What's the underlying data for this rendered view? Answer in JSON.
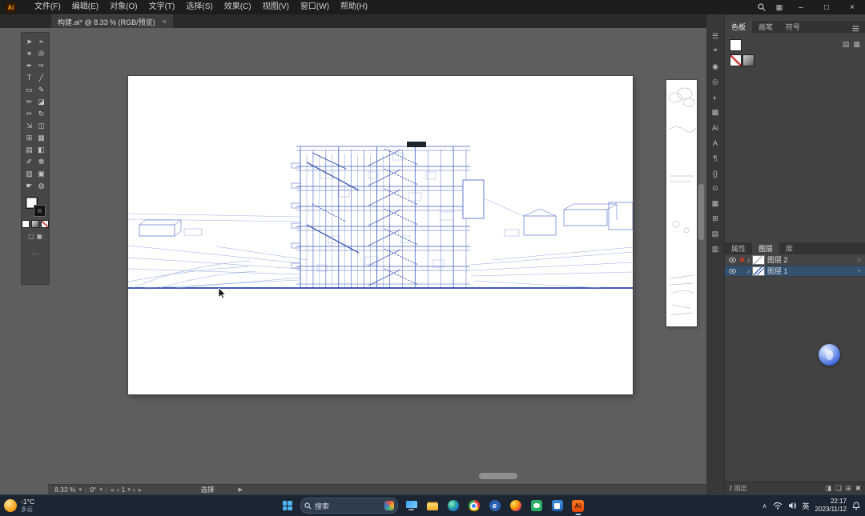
{
  "colors": {
    "selection": "#33506f",
    "ai_orange": "#ff9a00",
    "blueprint": "#3c5cc0",
    "blueprint_dark": "#2344a8",
    "blueprint_light": "#8aa0dc"
  },
  "titlebar": {
    "logo_text": "Ai",
    "menus": [
      "文件(F)",
      "编辑(E)",
      "对象(O)",
      "文字(T)",
      "选择(S)",
      "效果(C)",
      "视图(V)",
      "窗口(W)",
      "帮助(H)"
    ],
    "workspace_glyph": "▦",
    "window_controls": {
      "minimize": "–",
      "restore": "□",
      "close": "×"
    }
  },
  "tabbar": {
    "doc_title": "构建.ai* @ 8.33 % (RGB/预览)",
    "close_glyph": "×"
  },
  "toolbar": {
    "tools": [
      {
        "name": "selection-tool",
        "glyph": "➤"
      },
      {
        "name": "direct-selection-tool",
        "glyph": "➣"
      },
      {
        "name": "magic-wand-tool",
        "glyph": "✶"
      },
      {
        "name": "lasso-tool",
        "glyph": "✇"
      },
      {
        "name": "pen-tool",
        "glyph": "✒"
      },
      {
        "name": "curvature-tool",
        "glyph": "✑"
      },
      {
        "name": "type-tool",
        "glyph": "T"
      },
      {
        "name": "line-segment-tool",
        "glyph": "╱"
      },
      {
        "name": "rectangle-tool",
        "glyph": "▭"
      },
      {
        "name": "paintbrush-tool",
        "glyph": "✎"
      },
      {
        "name": "pencil-tool",
        "glyph": "✏"
      },
      {
        "name": "eraser-tool",
        "glyph": "◪"
      },
      {
        "name": "scissors-tool",
        "glyph": "✂"
      },
      {
        "name": "rotate-tool",
        "glyph": "↻"
      },
      {
        "name": "scale-tool",
        "glyph": "⇲"
      },
      {
        "name": "width-tool",
        "glyph": "◫"
      },
      {
        "name": "free-transform-tool",
        "glyph": "⊞"
      },
      {
        "name": "perspective-grid-tool",
        "glyph": "▦"
      },
      {
        "name": "mesh-tool",
        "glyph": "▤"
      },
      {
        "name": "gradient-tool",
        "glyph": "◧"
      },
      {
        "name": "eyedropper-tool",
        "glyph": "✐"
      },
      {
        "name": "symbol-sprayer-tool",
        "glyph": "❁"
      },
      {
        "name": "column-graph-tool",
        "glyph": "▥"
      },
      {
        "name": "artboard-tool",
        "glyph": "▣"
      },
      {
        "name": "hand-tool",
        "glyph": "☛"
      },
      {
        "name": "zoom-tool",
        "glyph": "◍"
      }
    ],
    "more_glyph": "…"
  },
  "statusbar": {
    "zoom": "8.33 %",
    "caret": "▾",
    "rotation": "0°",
    "nav_first": "«",
    "nav_prev": "‹",
    "artboard_number": "1",
    "nav_next": "›",
    "nav_last": "»",
    "status_text": "选择",
    "expand_glyph": "▶"
  },
  "panel_strip": {
    "icons": [
      {
        "name": "panel-menu-icon",
        "glyph": "☰"
      },
      {
        "name": "comments-panel-icon",
        "glyph": "❝"
      },
      {
        "name": "color-panel-icon",
        "glyph": "◉"
      },
      {
        "name": "color-guide-panel-icon",
        "glyph": "◎"
      },
      {
        "name": "gradient-panel-icon",
        "glyph": "◐"
      },
      {
        "name": "transparency-panel-icon",
        "glyph": "▩"
      },
      {
        "name": "libraries-panel-icon",
        "glyph": "Ai"
      },
      {
        "name": "character-panel-icon",
        "glyph": "A"
      },
      {
        "name": "paragraph-panel-icon",
        "glyph": "¶"
      },
      {
        "name": "opentype-panel-icon",
        "glyph": "{}"
      },
      {
        "name": "appearance-panel-icon",
        "glyph": "⊙"
      },
      {
        "name": "graphic-styles-panel-icon",
        "glyph": "▦"
      },
      {
        "name": "symbols-panel-icon",
        "glyph": "⊞"
      },
      {
        "name": "asset-export-panel-icon",
        "glyph": "▤"
      },
      {
        "name": "artboards-panel-icon",
        "glyph": "▥"
      }
    ]
  },
  "swatches_panel": {
    "tabs": [
      {
        "label": "色板",
        "active": true
      },
      {
        "label": "画笔"
      },
      {
        "label": "符号"
      }
    ],
    "menu_glyph": "≡",
    "view_list_glyph": "▤",
    "view_grid_glyph": "▦"
  },
  "layers_panel": {
    "tabs": [
      {
        "label": "属性"
      },
      {
        "label": "图层",
        "active": true
      },
      {
        "label": "库"
      }
    ],
    "menu_glyph": "≡",
    "rows": [
      {
        "expand": "›",
        "name": "图层 2",
        "target": "○"
      },
      {
        "expand": "›",
        "name": "图层 1",
        "target": "○",
        "selected": true
      }
    ],
    "footer": {
      "count": "2 图层",
      "icons": [
        {
          "name": "make-mask-icon",
          "glyph": "◨"
        },
        {
          "name": "new-sublayer-icon",
          "glyph": "❏"
        },
        {
          "name": "new-layer-icon",
          "glyph": "⊞"
        },
        {
          "name": "delete-layer-icon",
          "glyph": "✖"
        }
      ]
    }
  },
  "taskbar": {
    "weather": {
      "temp": "-1°C",
      "desc": "多云"
    },
    "search_text": "搜索",
    "apps": [
      {
        "name": "monitor"
      },
      {
        "name": "file-explorer"
      },
      {
        "name": "edge"
      },
      {
        "name": "chrome"
      },
      {
        "name": "browser",
        "glyph": "e"
      },
      {
        "name": "firefox"
      },
      {
        "name": "wechat"
      },
      {
        "name": "docs"
      },
      {
        "name": "illustrator",
        "glyph": "Ai",
        "active": true
      }
    ],
    "tray": {
      "chevron": "∧",
      "ime": "英",
      "time": "22:17",
      "date": "2023/11/12"
    }
  }
}
